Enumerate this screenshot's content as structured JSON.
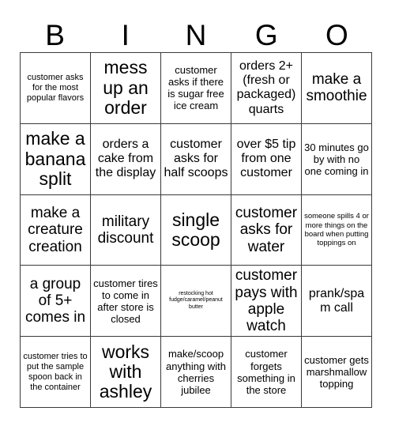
{
  "card": {
    "title_letters": [
      "B",
      "I",
      "N",
      "G",
      "O"
    ],
    "columns": 5,
    "rows": 5,
    "grid_line_color": "#3a3a3a",
    "text_color": "#000000",
    "background_color": "#ffffff",
    "cells": [
      {
        "text": "customer asks for the most popular flavors",
        "size": "s"
      },
      {
        "text": "mess up an order",
        "size": "xxl"
      },
      {
        "text": "customer asks if there is sugar free ice cream",
        "size": "m"
      },
      {
        "text": "orders 2+ (fresh or packaged) quarts",
        "size": "l"
      },
      {
        "text": "make a smoothie",
        "size": "xl"
      },
      {
        "text": "make a banana split",
        "size": "xxl"
      },
      {
        "text": "orders a cake from the display",
        "size": "l"
      },
      {
        "text": "customer asks for half scoops",
        "size": "l"
      },
      {
        "text": "over $5 tip from one customer",
        "size": "l"
      },
      {
        "text": "30 minutes go by with no one coming in",
        "size": "m"
      },
      {
        "text": "make a creature creation",
        "size": "xl"
      },
      {
        "text": "military discount",
        "size": "xl"
      },
      {
        "text": "single scoop",
        "size": "xxl"
      },
      {
        "text": "customer asks for water",
        "size": "xl"
      },
      {
        "text": "someone spills 4 or more things on the board when putting toppings on",
        "size": "xs"
      },
      {
        "text": "a group of 5+ comes in",
        "size": "xl"
      },
      {
        "text": "customer tires to come in after store is closed",
        "size": "m"
      },
      {
        "text": "restocking hot fudge/caramel/peanut butter",
        "size": "xxs"
      },
      {
        "text": "customer pays with apple watch",
        "size": "xl"
      },
      {
        "text": "prank/spam call",
        "size": "l"
      },
      {
        "text": "customer tries to put the sample spoon back in the container",
        "size": "s"
      },
      {
        "text": "works with ashley",
        "size": "xxl"
      },
      {
        "text": "make/scoop anything with cherries jubilee",
        "size": "m"
      },
      {
        "text": "customer forgets something in the store",
        "size": "m"
      },
      {
        "text": "customer gets marshmallow topping",
        "size": "m"
      }
    ]
  }
}
